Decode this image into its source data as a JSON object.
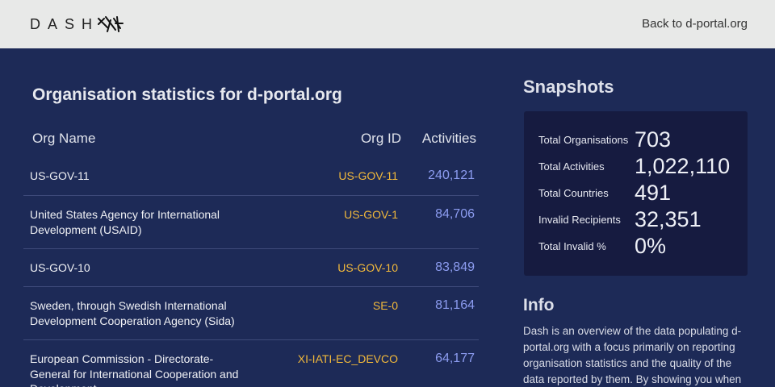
{
  "header": {
    "logo_text": "DASH",
    "back_link": "Back to d-portal.org"
  },
  "main": {
    "title": "Organisation statistics for d-portal.org",
    "columns": {
      "name": "Org Name",
      "id": "Org ID",
      "activities": "Activities"
    },
    "rows": [
      {
        "name": "US-GOV-11",
        "id": "US-GOV-11",
        "activities": "240,121"
      },
      {
        "name": "United States Agency for International Development (USAID)",
        "id": "US-GOV-1",
        "activities": "84,706"
      },
      {
        "name": "US-GOV-10",
        "id": "US-GOV-10",
        "activities": "83,849"
      },
      {
        "name": "Sweden, through Swedish International Development Cooperation Agency (Sida)",
        "id": "SE-0",
        "activities": "81,164"
      },
      {
        "name": "European Commission - Directorate-General for International Cooperation and Development",
        "id": "XI-IATI-EC_DEVCO",
        "activities": "64,177"
      }
    ]
  },
  "snapshots": {
    "title": "Snapshots",
    "stats": [
      {
        "label": "Total Organisations",
        "value": "703"
      },
      {
        "label": "Total Activities",
        "value": "1,022,110"
      },
      {
        "label": "Total Countries",
        "value": "491"
      },
      {
        "label": "Invalid Recipients",
        "value": "32,351"
      },
      {
        "label": "Total Invalid %",
        "value": "0%"
      }
    ]
  },
  "info": {
    "title": "Info",
    "text": "Dash is an overview of the data populating d-portal.org with a focus primarily on reporting organisation statistics and the quality of the data reported by them. By showing you when"
  },
  "colors": {
    "background": "#1d2a57",
    "topbar": "#e8e9e8",
    "org_id": "#f2b93b",
    "activities": "#8c9cf0",
    "snapshot_panel": "#161b40"
  }
}
